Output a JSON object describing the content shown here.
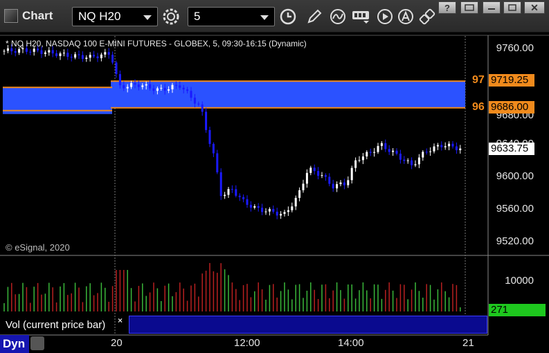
{
  "app": {
    "title": "Chart"
  },
  "toolbar": {
    "symbol": "NQ H20",
    "interval": "5"
  },
  "chart": {
    "title": "* NQ H20, NASDAQ 100 E-MINI FUTURES - GLOBEX, 5, 09:30-16:15 (Dynamic)",
    "copyright": "© eSignal, 2020",
    "price_labels": [
      "9760.00",
      "9680.00",
      "9640.00",
      "9600.00",
      "9560.00",
      "9520.00"
    ],
    "level_upper": {
      "tag": "9719.25",
      "short": "97",
      "value": 9719.25
    },
    "level_lower": {
      "tag": "9686.00",
      "short": "96",
      "value": 9686.0
    },
    "last_price": "9633.75",
    "time_labels": [
      "20",
      "12:00",
      "14:00",
      "21"
    ],
    "colors": {
      "zone_fill": "#2b52ff",
      "level_line": "#f08a1c",
      "bull_candle": "#ffffff",
      "bear_candle": "#1a1aff",
      "vol_up": "#3ab83a",
      "vol_down": "#b82020"
    }
  },
  "volume": {
    "label": "Vol (current price bar)",
    "close_glyph": "×",
    "scale_label": "10000",
    "current_value": "271"
  },
  "footer": {
    "mode": "Dyn"
  }
}
